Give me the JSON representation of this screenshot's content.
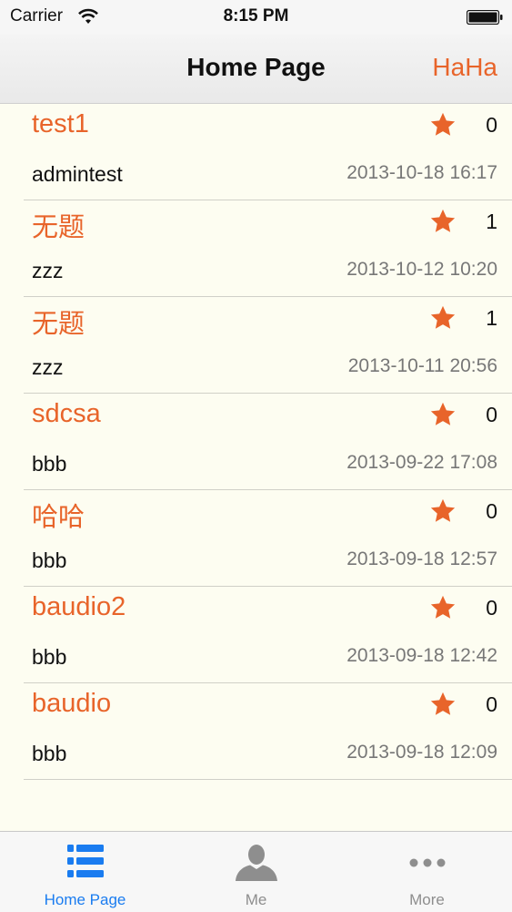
{
  "status_bar": {
    "carrier": "Carrier",
    "time": "8:15 PM"
  },
  "nav": {
    "title": "Home Page",
    "right_button": "HaHa"
  },
  "colors": {
    "accent": "#e8642a",
    "tab_active": "#1a7cf0",
    "background": "#fdfdf1"
  },
  "posts": [
    {
      "title": "test1",
      "count": "0",
      "author": "admintest",
      "date": "2013-10-18 16:17"
    },
    {
      "title": "无题",
      "count": "1",
      "author": "zzz",
      "date": "2013-10-12 10:20"
    },
    {
      "title": "无题",
      "count": "1",
      "author": "zzz",
      "date": "2013-10-11 20:56"
    },
    {
      "title": "sdcsa",
      "count": "0",
      "author": "bbb",
      "date": "2013-09-22 17:08"
    },
    {
      "title": "哈哈",
      "count": "0",
      "author": "bbb",
      "date": "2013-09-18 12:57"
    },
    {
      "title": "baudio2",
      "count": "0",
      "author": "bbb",
      "date": "2013-09-18 12:42"
    },
    {
      "title": "baudio",
      "count": "0",
      "author": "bbb",
      "date": "2013-09-18 12:09"
    }
  ],
  "tabs": [
    {
      "label": "Home Page",
      "icon": "list-icon",
      "active": true
    },
    {
      "label": "Me",
      "icon": "person-icon",
      "active": false
    },
    {
      "label": "More",
      "icon": "more-icon",
      "active": false
    }
  ]
}
